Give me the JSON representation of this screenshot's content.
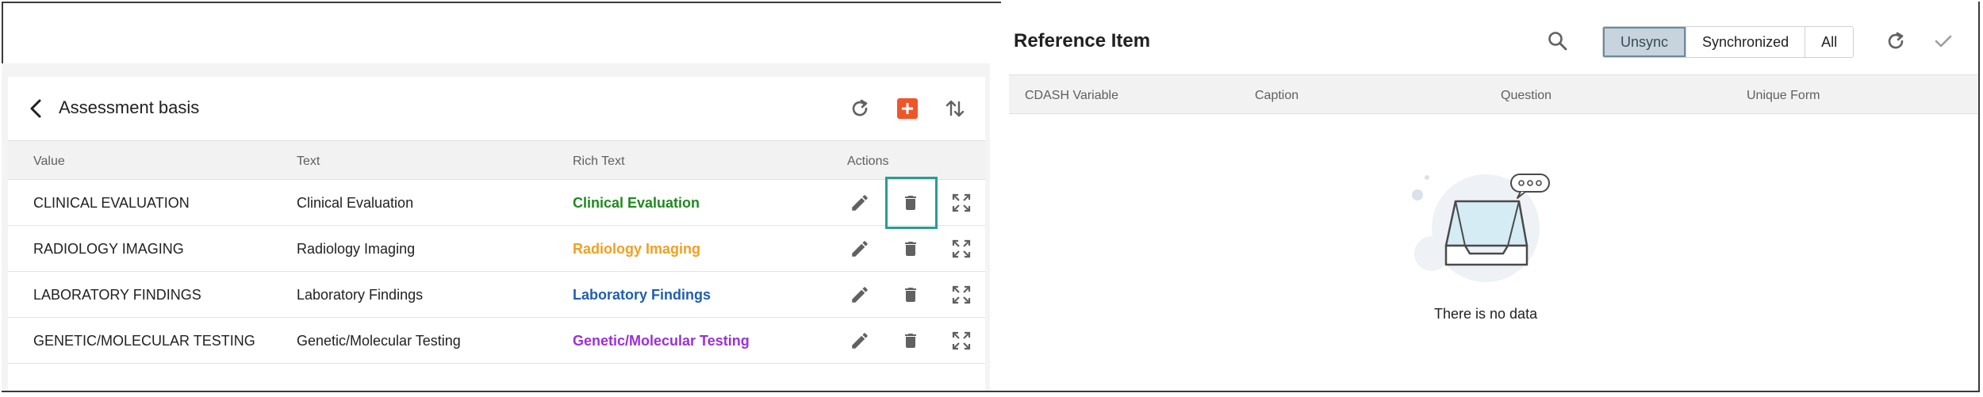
{
  "left": {
    "title": "Assessment basis",
    "icons": {
      "back": "arrow-left-icon",
      "refresh": "refresh-icon",
      "add": "add-box-icon",
      "sort": "sort-arrows-icon"
    },
    "accent_color": "#f0552a",
    "columns": [
      "Value",
      "Text",
      "Rich Text",
      "Actions"
    ],
    "rows": [
      {
        "value": "CLINICAL EVALUATION",
        "text": "Clinical Evaluation",
        "rich": "Clinical Evaluation",
        "rich_color": "#1e8a1e"
      },
      {
        "value": "RADIOLOGY IMAGING",
        "text": "Radiology Imaging",
        "rich": "Radiology Imaging",
        "rich_color": "#f0a024"
      },
      {
        "value": "LABORATORY FINDINGS",
        "text": "Laboratory Findings",
        "rich": "Laboratory Findings",
        "rich_color": "#1f5fae"
      },
      {
        "value": "GENETIC/MOLECULAR TESTING",
        "text": "Genetic/Molecular Testing",
        "rich": "Genetic/Molecular Testing",
        "rich_color": "#9b30d9"
      }
    ],
    "row_action_icons": [
      "edit-icon",
      "delete-icon",
      "expand-icon"
    ]
  },
  "right": {
    "title": "Reference Item",
    "icons": {
      "search": "search-icon",
      "refresh": "refresh-icon",
      "confirm": "check-icon"
    },
    "filters": [
      "Unsync",
      "Synchronized",
      "All"
    ],
    "active_filter": "Unsync",
    "columns": [
      "CDASH Variable",
      "Caption",
      "Question",
      "Unique Form"
    ],
    "empty_message": "There is no data"
  }
}
